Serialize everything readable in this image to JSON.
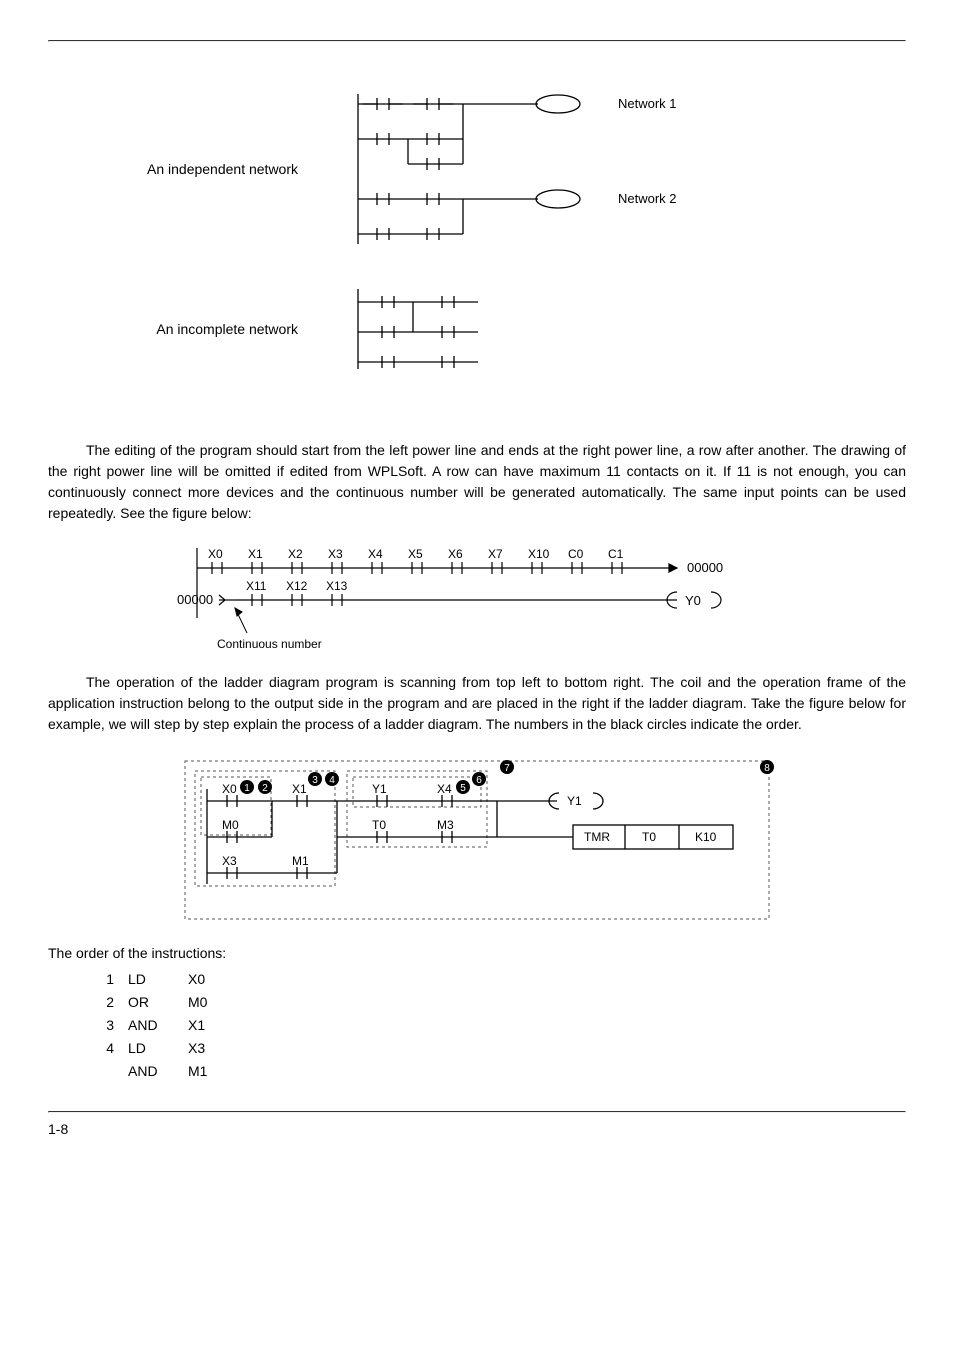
{
  "labels": {
    "independent": "An independent network",
    "incomplete": "An incomplete network",
    "network1": "Network 1",
    "network2": "Network 2",
    "continuous": "Continuous number",
    "orderHead": "The order of the instructions:",
    "pageNo": "1-8"
  },
  "contacts_line1": [
    "X0",
    "X1",
    "X2",
    "X3",
    "X4",
    "X5",
    "X6",
    "X7",
    "X10",
    "C0",
    "C1"
  ],
  "line1_end": "00000",
  "contacts_line2_lead": "00000",
  "contacts_line2": [
    "X11",
    "X12",
    "X13"
  ],
  "coil_line2": "Y0",
  "para1": "The editing of the program should start from the left power line and ends at the right power line, a row after another. The drawing of the right power line will be omitted if edited from WPLSoft. A row can have maximum 11 contacts on it. If 11 is not enough, you can continuously connect more devices and the continuous number will be generated automatically. The same input points can be used repeatedly. See the figure below:",
  "para2": "The operation of the ladder diagram program is scanning from top left to bottom right. The coil and the operation frame of the application instruction belong to the output side in the program and are placed in the right if the ladder diagram. Take the figure below for example, we will step by step explain the process of a ladder diagram. The numbers in the black circles indicate the order.",
  "ladder2": {
    "row1": [
      "X0",
      "X1",
      "Y1",
      "X4"
    ],
    "row2": [
      "M0",
      "T0",
      "M3"
    ],
    "row3": [
      "X3",
      "M1"
    ],
    "coil": "Y1",
    "box": [
      "TMR",
      "T0",
      "K10"
    ]
  },
  "circles": [
    "1",
    "2",
    "3",
    "4",
    "5",
    "6",
    "7",
    "8"
  ],
  "instructions": [
    {
      "n": "1",
      "op": "LD",
      "arg": "X0"
    },
    {
      "n": "2",
      "op": "OR",
      "arg": "M0"
    },
    {
      "n": "3",
      "op": "AND",
      "arg": "X1"
    },
    {
      "n": "4",
      "op": "LD",
      "arg": "X3"
    },
    {
      "n": "",
      "op": "AND",
      "arg": "M1"
    }
  ]
}
